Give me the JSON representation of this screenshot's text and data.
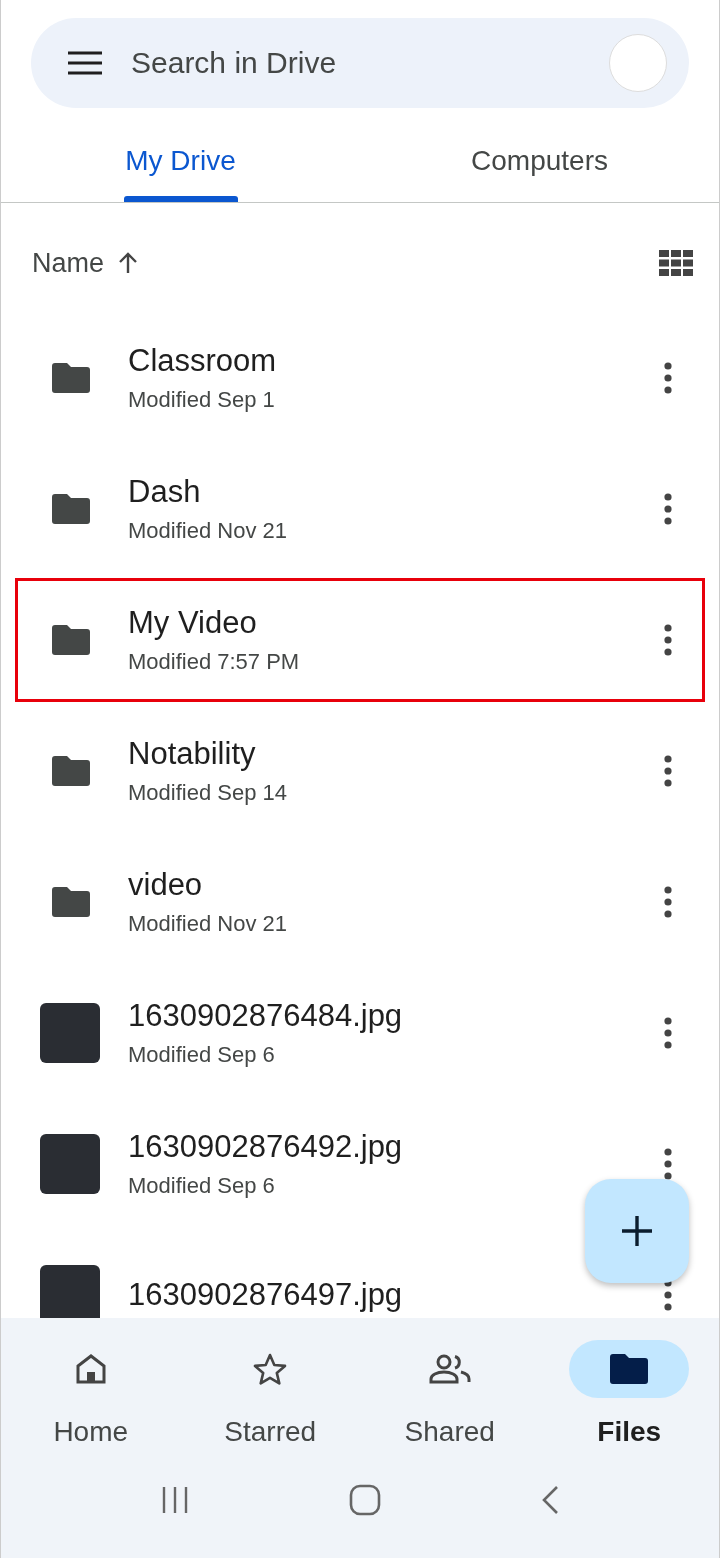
{
  "search": {
    "placeholder": "Search in Drive"
  },
  "tabs": [
    {
      "label": "My Drive",
      "selected": true
    },
    {
      "label": "Computers",
      "selected": false
    }
  ],
  "sort": {
    "label": "Name"
  },
  "files": [
    {
      "kind": "folder",
      "name": "Classroom",
      "modified": "Modified Sep 1",
      "highlighted": false
    },
    {
      "kind": "folder",
      "name": "Dash",
      "modified": "Modified Nov 21",
      "highlighted": false
    },
    {
      "kind": "folder",
      "name": "My Video",
      "modified": "Modified 7:57 PM",
      "highlighted": true
    },
    {
      "kind": "folder",
      "name": "Notability",
      "modified": "Modified Sep 14",
      "highlighted": false
    },
    {
      "kind": "folder",
      "name": "video",
      "modified": "Modified Nov 21",
      "highlighted": false
    },
    {
      "kind": "image",
      "name": "1630902876484.jpg",
      "modified": "Modified Sep 6",
      "highlighted": false
    },
    {
      "kind": "image",
      "name": "1630902876492.jpg",
      "modified": "Modified Sep 6",
      "highlighted": false
    },
    {
      "kind": "image",
      "name": "1630902876497.jpg",
      "highlighted": false
    }
  ],
  "nav": [
    {
      "kind": "home",
      "label": "Home",
      "selected": false
    },
    {
      "kind": "star",
      "label": "Starred",
      "selected": false
    },
    {
      "kind": "people",
      "label": "Shared",
      "selected": false
    },
    {
      "kind": "folder",
      "label": "Files",
      "selected": true
    }
  ]
}
